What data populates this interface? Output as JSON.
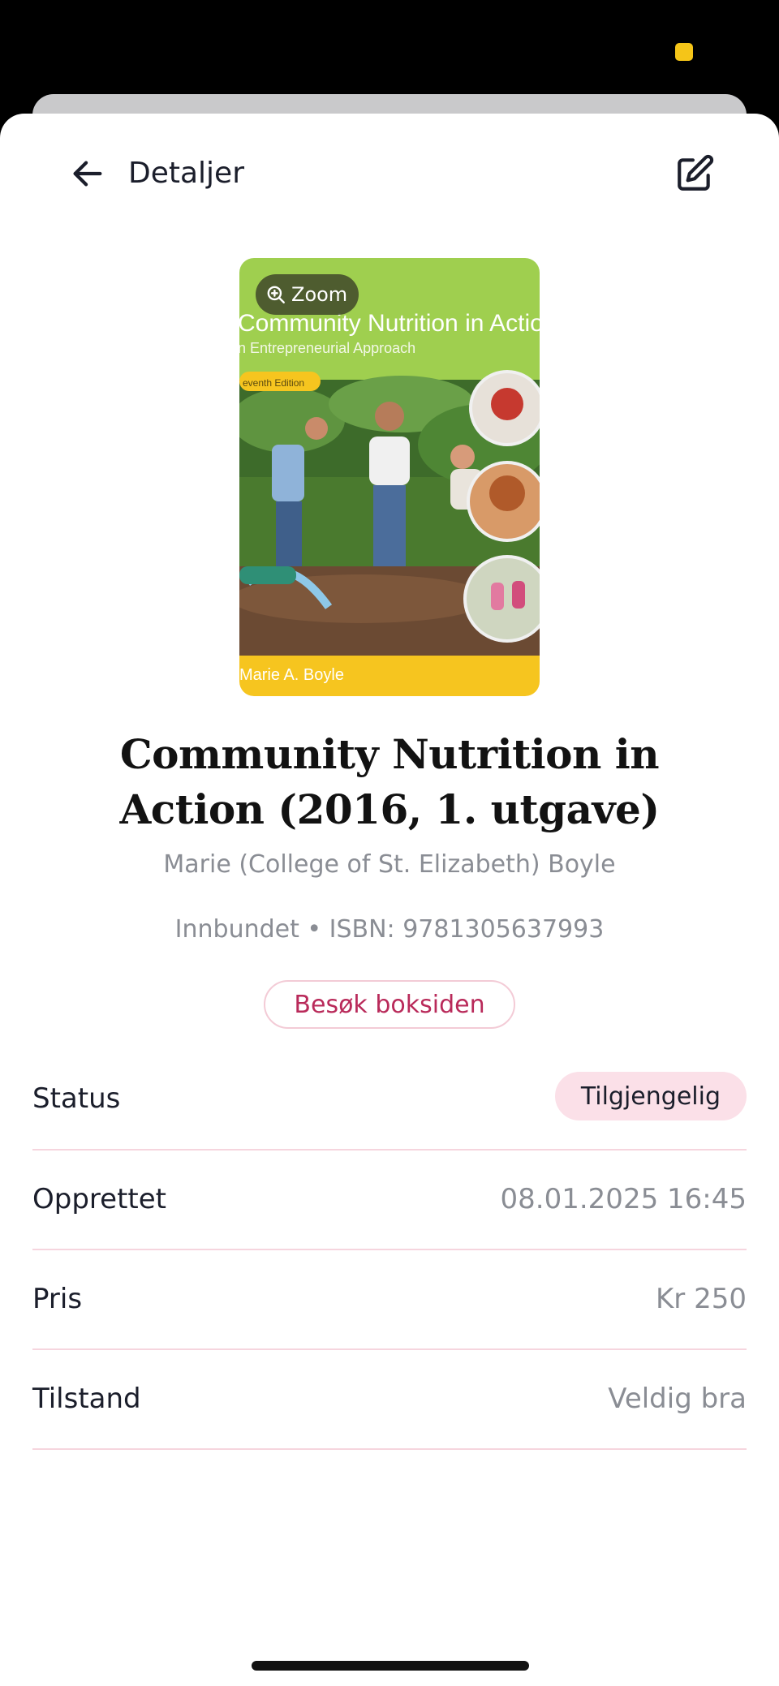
{
  "header": {
    "title": "Detaljer"
  },
  "book": {
    "zoom_label": "Zoom",
    "title": "Community Nutrition in Action (2016, 1. utgave)",
    "author": "Marie (College of St. Elizabeth) Boyle",
    "meta": "Innbundet • ISBN: 9781305637993",
    "visit_label": "Besøk boksiden",
    "cover": {
      "cover_title": "Community Nutrition in Actio",
      "cover_subtitle": "n Entrepreneurial Approach",
      "cover_edition": "eventh Edition",
      "cover_author": "Marie A. Boyle"
    }
  },
  "details": [
    {
      "label": "Status",
      "value": "Tilgjengelig"
    },
    {
      "label": "Opprettet",
      "value": "08.01.2025 16:45"
    },
    {
      "label": "Pris",
      "value": "Kr 250"
    },
    {
      "label": "Tilstand",
      "value": "Veldig bra"
    }
  ],
  "colors": {
    "accent": "#b92a5a",
    "badge_bg": "#fbe0e8",
    "divider": "#f6d5de",
    "muted_text": "#8a8d94"
  },
  "icons": {
    "back": "arrow-left-icon",
    "edit": "edit-icon",
    "zoom": "zoom-in-icon"
  }
}
